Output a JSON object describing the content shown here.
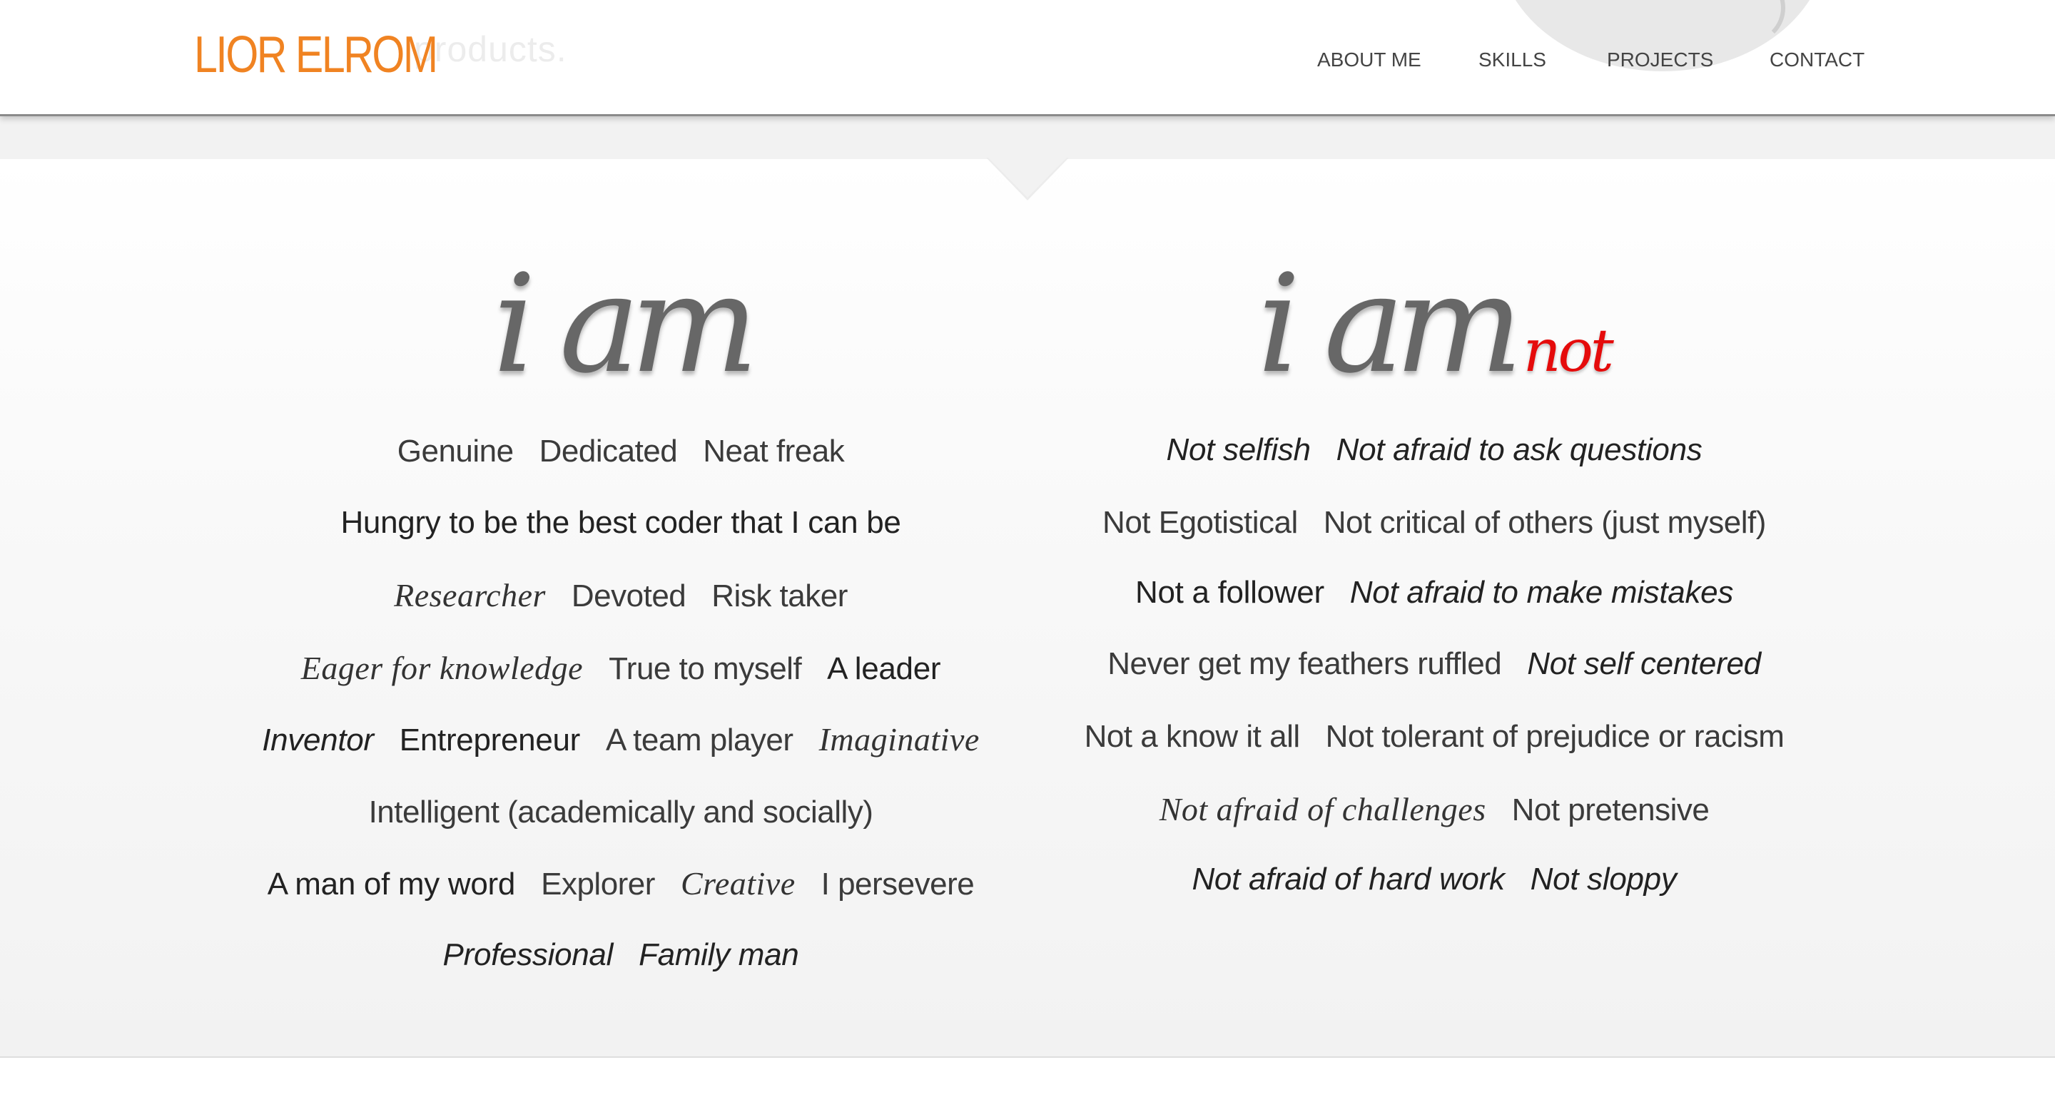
{
  "header": {
    "logo": "LIOR ELROM",
    "ghost_text": "products.",
    "nav": [
      {
        "label": "ABOUT ME"
      },
      {
        "label": "SKILLS"
      },
      {
        "label": "PROJECTS"
      },
      {
        "label": "CONTACT"
      }
    ]
  },
  "left": {
    "heading": "i am",
    "rows": [
      [
        {
          "text": "Genuine",
          "style": "light"
        },
        {
          "text": "Dedicated",
          "style": "light"
        },
        {
          "text": "Neat freak",
          "style": "light"
        }
      ],
      [
        {
          "text": "Hungry to be the best coder that I can be",
          "style": "medium"
        }
      ],
      [
        {
          "text": "Researcher",
          "style": "serif"
        },
        {
          "text": "Devoted",
          "style": "light"
        },
        {
          "text": "Risk taker",
          "style": "light"
        }
      ],
      [
        {
          "text": "Eager for knowledge",
          "style": "serif"
        },
        {
          "text": "True to myself",
          "style": "light"
        },
        {
          "text": "A leader",
          "style": "medium"
        }
      ],
      [
        {
          "text": "Inventor",
          "style": "italic"
        },
        {
          "text": "Entrepreneur",
          "style": "medium"
        },
        {
          "text": "A team player",
          "style": "light"
        },
        {
          "text": "Imaginative",
          "style": "serif"
        }
      ],
      [
        {
          "text": "Intelligent (academically and socially)",
          "style": "light"
        }
      ],
      [
        {
          "text": "A man of my word",
          "style": "medium"
        },
        {
          "text": "Explorer",
          "style": "light"
        },
        {
          "text": "Creative",
          "style": "serif"
        },
        {
          "text": "I persevere",
          "style": "light"
        }
      ],
      [
        {
          "text": "Professional",
          "style": "italic"
        },
        {
          "text": "Family man",
          "style": "italic"
        }
      ]
    ]
  },
  "right": {
    "heading": "i am",
    "heading_suffix": "not",
    "rows": [
      [
        {
          "text": "Not selfish",
          "style": "italic"
        },
        {
          "text": "Not afraid to ask questions",
          "style": "italic"
        }
      ],
      [
        {
          "text": "Not Egotistical",
          "style": "light"
        },
        {
          "text": "Not critical of others (just myself)",
          "style": "light"
        }
      ],
      [
        {
          "text": "Not a follower",
          "style": "medium"
        },
        {
          "text": "Not afraid to make mistakes",
          "style": "italic"
        }
      ],
      [
        {
          "text": "Never get my feathers ruffled",
          "style": "light"
        },
        {
          "text": "Not self centered",
          "style": "italic"
        }
      ],
      [
        {
          "text": "Not a know it all",
          "style": "light"
        },
        {
          "text": "Not tolerant of prejudice or racism",
          "style": "light"
        }
      ],
      [
        {
          "text": "Not afraid of challenges",
          "style": "serif"
        },
        {
          "text": "Not pretensive",
          "style": "light"
        }
      ],
      [
        {
          "text": "Not afraid of hard work",
          "style": "italic"
        },
        {
          "text": "Not sloppy",
          "style": "italic"
        }
      ]
    ]
  },
  "colors": {
    "logo": "#f08322",
    "heading": "#676767",
    "accent_not": "#e50b0b",
    "nav_text": "#444444"
  }
}
